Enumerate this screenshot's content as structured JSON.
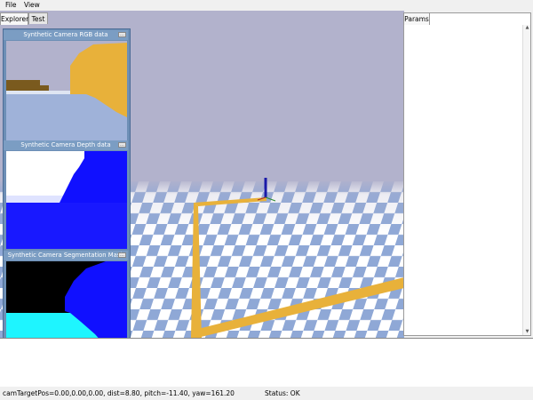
{
  "menu": {
    "file": "File",
    "view": "View"
  },
  "left_tabs": [
    {
      "label": "Explorer"
    },
    {
      "label": "Test"
    }
  ],
  "cameras": [
    {
      "title": "Synthetic Camera RGB data",
      "button": "…"
    },
    {
      "title": "Synthetic Camera Depth data",
      "button": "…"
    },
    {
      "title": "Synthetic Camera Segmentation Mask",
      "button": "…"
    }
  ],
  "params": {
    "tab_label": "Params"
  },
  "status": {
    "camera": "camTargetPos=0.00,0.00,0.00, dist=8.80, pitch=-11.40, yaw=161.20",
    "state": "Status: OK"
  },
  "colors": {
    "floor_light": "#ffffff",
    "floor_dark": "#8fa8d6",
    "sky": "#b2b2cc",
    "path": "#e8b13a",
    "depth_blue": "#1010ff",
    "seg_cyan": "#1ef5ff"
  }
}
